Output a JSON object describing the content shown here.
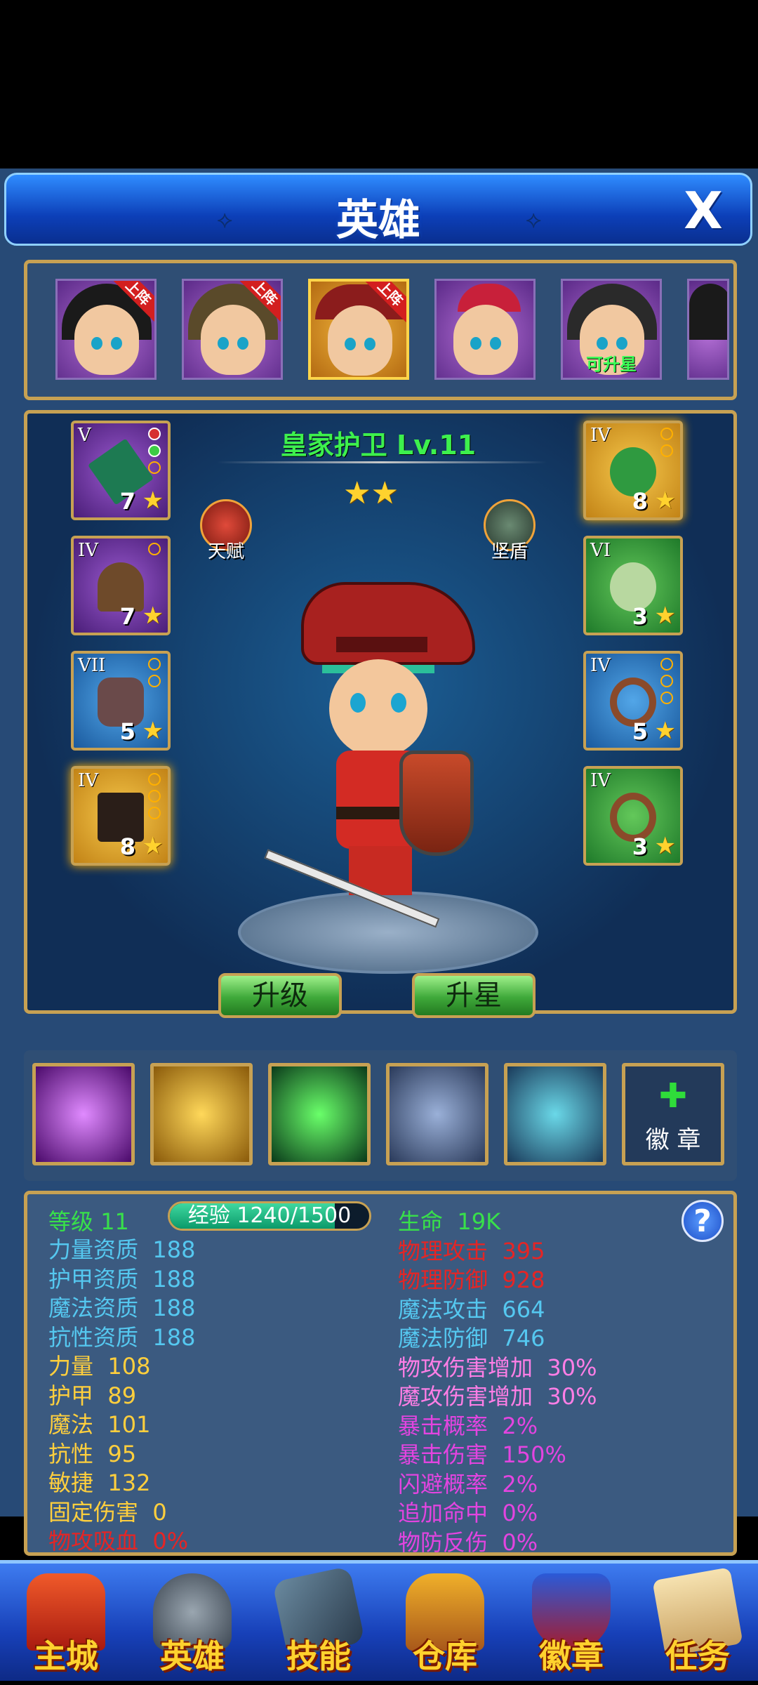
{
  "window": {
    "title": "英雄",
    "title_ornament_left": "⟡",
    "title_ornament_right": "⟡",
    "close_label": "X"
  },
  "roster": {
    "heroes": [
      {
        "badge": "上阵",
        "upgrade": ""
      },
      {
        "badge": "上阵",
        "upgrade": ""
      },
      {
        "badge": "上阵",
        "upgrade": ""
      },
      {
        "badge": "",
        "upgrade": ""
      },
      {
        "badge": "",
        "upgrade": "可升星"
      },
      {
        "badge": "",
        "upgrade": ""
      }
    ]
  },
  "hero": {
    "name": "皇家护卫 Lv.11",
    "stars": "★★",
    "talent_label": "天赋",
    "trait_label": "坚盾",
    "upgrade_button": "升级",
    "star_up_button": "升星"
  },
  "equipment": {
    "left": [
      {
        "tier": "V",
        "level": "7",
        "star": "★"
      },
      {
        "tier": "IV",
        "level": "7",
        "star": "★"
      },
      {
        "tier": "VII",
        "level": "5",
        "star": "★"
      },
      {
        "tier": "IV",
        "level": "8",
        "star": "★"
      }
    ],
    "right": [
      {
        "tier": "IV",
        "level": "8",
        "star": "★"
      },
      {
        "tier": "VI",
        "level": "3",
        "star": "★"
      },
      {
        "tier": "IV",
        "level": "5",
        "star": "★"
      },
      {
        "tier": "IV",
        "level": "3",
        "star": "★"
      }
    ]
  },
  "skills": {
    "badge_plus": "✚",
    "badge_label": "徽 章"
  },
  "stats": {
    "level_label": "等级",
    "level_value": "11",
    "exp_text": "经验 1240/1500",
    "exp_fraction": 0.8267,
    "help": "?",
    "left": [
      {
        "label": "力量资质",
        "value": "188"
      },
      {
        "label": "护甲资质",
        "value": "188"
      },
      {
        "label": "魔法资质",
        "value": "188"
      },
      {
        "label": "抗性资质",
        "value": "188"
      },
      {
        "label": "力量",
        "value": "108"
      },
      {
        "label": "护甲",
        "value": "89"
      },
      {
        "label": "魔法",
        "value": "101"
      },
      {
        "label": "抗性",
        "value": "95"
      },
      {
        "label": "敏捷",
        "value": "132"
      },
      {
        "label": "固定伤害",
        "value": "0"
      },
      {
        "label": "物攻吸血",
        "value": "0%"
      }
    ],
    "right": [
      {
        "label": "生命",
        "value": "19K"
      },
      {
        "label": "物理攻击",
        "value": "395"
      },
      {
        "label": "物理防御",
        "value": "928"
      },
      {
        "label": "魔法攻击",
        "value": "664"
      },
      {
        "label": "魔法防御",
        "value": "746"
      },
      {
        "label": "物攻伤害增加",
        "value": "30%"
      },
      {
        "label": "魔攻伤害增加",
        "value": "30%"
      },
      {
        "label": "暴击概率",
        "value": "2%"
      },
      {
        "label": "暴击伤害",
        "value": "150%"
      },
      {
        "label": "闪避概率",
        "value": "2%"
      },
      {
        "label": "追加命中",
        "value": "0%"
      },
      {
        "label": "物防反伤",
        "value": "0%"
      }
    ]
  },
  "nav": [
    {
      "label": "主城"
    },
    {
      "label": "英雄"
    },
    {
      "label": "技能"
    },
    {
      "label": "仓库"
    },
    {
      "label": "徽章"
    },
    {
      "label": "任务"
    }
  ]
}
